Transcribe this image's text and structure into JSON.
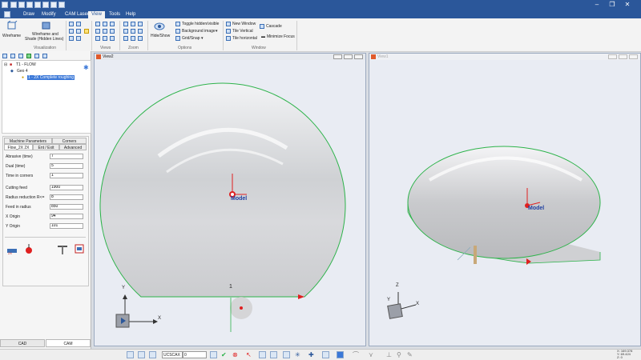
{
  "menu": [
    "Draw",
    "Modify",
    "CAM Laser",
    "View",
    "Tools",
    "Help"
  ],
  "ribbon": {
    "wireframe": "Wireframe",
    "wireframe_shade_1": "Wireframe and",
    "wireframe_shade_2": "Shade (Hidden Lines)",
    "hide_show": "Hide/Show",
    "toggle_hidden": "Toggle hidden/visible",
    "background_image": "Background image",
    "grid_snap": "Grid/Snap",
    "new_window": "New Window",
    "cascade": "Cascade",
    "tile_vertical": "Tile Vertical",
    "tile_horizontal": "Tile horizontal",
    "minimize_focus": "Minimize Focus",
    "groups": {
      "visualization": "Visualization",
      "views": "Views",
      "zoom": "Zoom",
      "options": "Options",
      "window": "Window"
    }
  },
  "tree": {
    "root": "T1 - FLOW",
    "geo": "Geo 4",
    "op": "1 - 2X Complete roughing"
  },
  "params": {
    "tabs_row1": [
      "Machine Parameters",
      "Corners"
    ],
    "tabs_row2": [
      "Flow_2X 2X",
      "Ent / Exit",
      "Advanced"
    ],
    "fields": [
      {
        "label": "Abrasive (time)",
        "value": "7"
      },
      {
        "label": "Dual (time)",
        "value": "5"
      },
      {
        "label": "Time in corners",
        "value": "1"
      },
      {
        "label": "Cutting feed",
        "value": "1900"
      },
      {
        "label": "Radius reduction R<=",
        "value": "8"
      },
      {
        "label": "Feed in radius",
        "value": "850"
      },
      {
        "label": "X Origin",
        "value": "94"
      },
      {
        "label": "Y Origin",
        "value": "101"
      }
    ]
  },
  "bottom_tabs": [
    "CAD",
    "CAM"
  ],
  "view2": {
    "title": "View2",
    "model_label": "Model",
    "axis_x": "X",
    "axis_y": "Y",
    "marker": "1"
  },
  "view1": {
    "title": "View1",
    "model_label": "Model",
    "axis_x": "X",
    "axis_y": "Y",
    "axis_z": "Z"
  },
  "status": {
    "ucs": "UCSCAX",
    "value": "0",
    "coord_x": "X: 169.378",
    "coord_y": "Y: 69.424",
    "coord_z": "Z: 0"
  },
  "colors": {
    "accent": "#2b579a",
    "outline": "#2db34a",
    "red": "#e02020"
  }
}
